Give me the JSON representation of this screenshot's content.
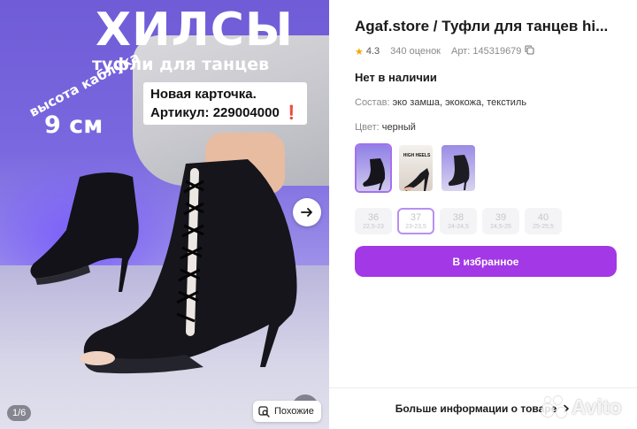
{
  "gallery": {
    "big_title": "ХИЛСЫ",
    "sub_title": "туфли для танцев",
    "heel_label": "высота каблука",
    "heel_value": "9 см",
    "promo_line1": "Новая карточка.",
    "promo_line2": "Артикул: 229004000",
    "promo_mark": "❗",
    "counter": "1/6",
    "similar_label": "Похожие"
  },
  "product": {
    "title": "Agaf.store / Туфли для танцев hi...",
    "rating": "4.3",
    "reviews": "340 оценок",
    "article": "Арт: 145319679",
    "stock": "Нет в наличии",
    "composition_label": "Состав:",
    "composition_value": "эко замша, экокожа, текстиль",
    "color_label": "Цвет:",
    "color_value": "черный",
    "thumb_caption_2a": "HIGH HEELS",
    "sizes": [
      {
        "n": "36",
        "r": "22,5-23"
      },
      {
        "n": "37",
        "r": "23-23,5"
      },
      {
        "n": "38",
        "r": "24-24,5"
      },
      {
        "n": "39",
        "r": "24,5-25"
      },
      {
        "n": "40",
        "r": "25-25,5"
      }
    ],
    "favorite_label": "В избранное",
    "more_info_label": "Больше информации о товаре"
  },
  "watermark": {
    "brand": "Avito"
  },
  "colors": {
    "accent": "#a238e6",
    "selected_border": "#b890ef",
    "star": "#f2a900"
  }
}
